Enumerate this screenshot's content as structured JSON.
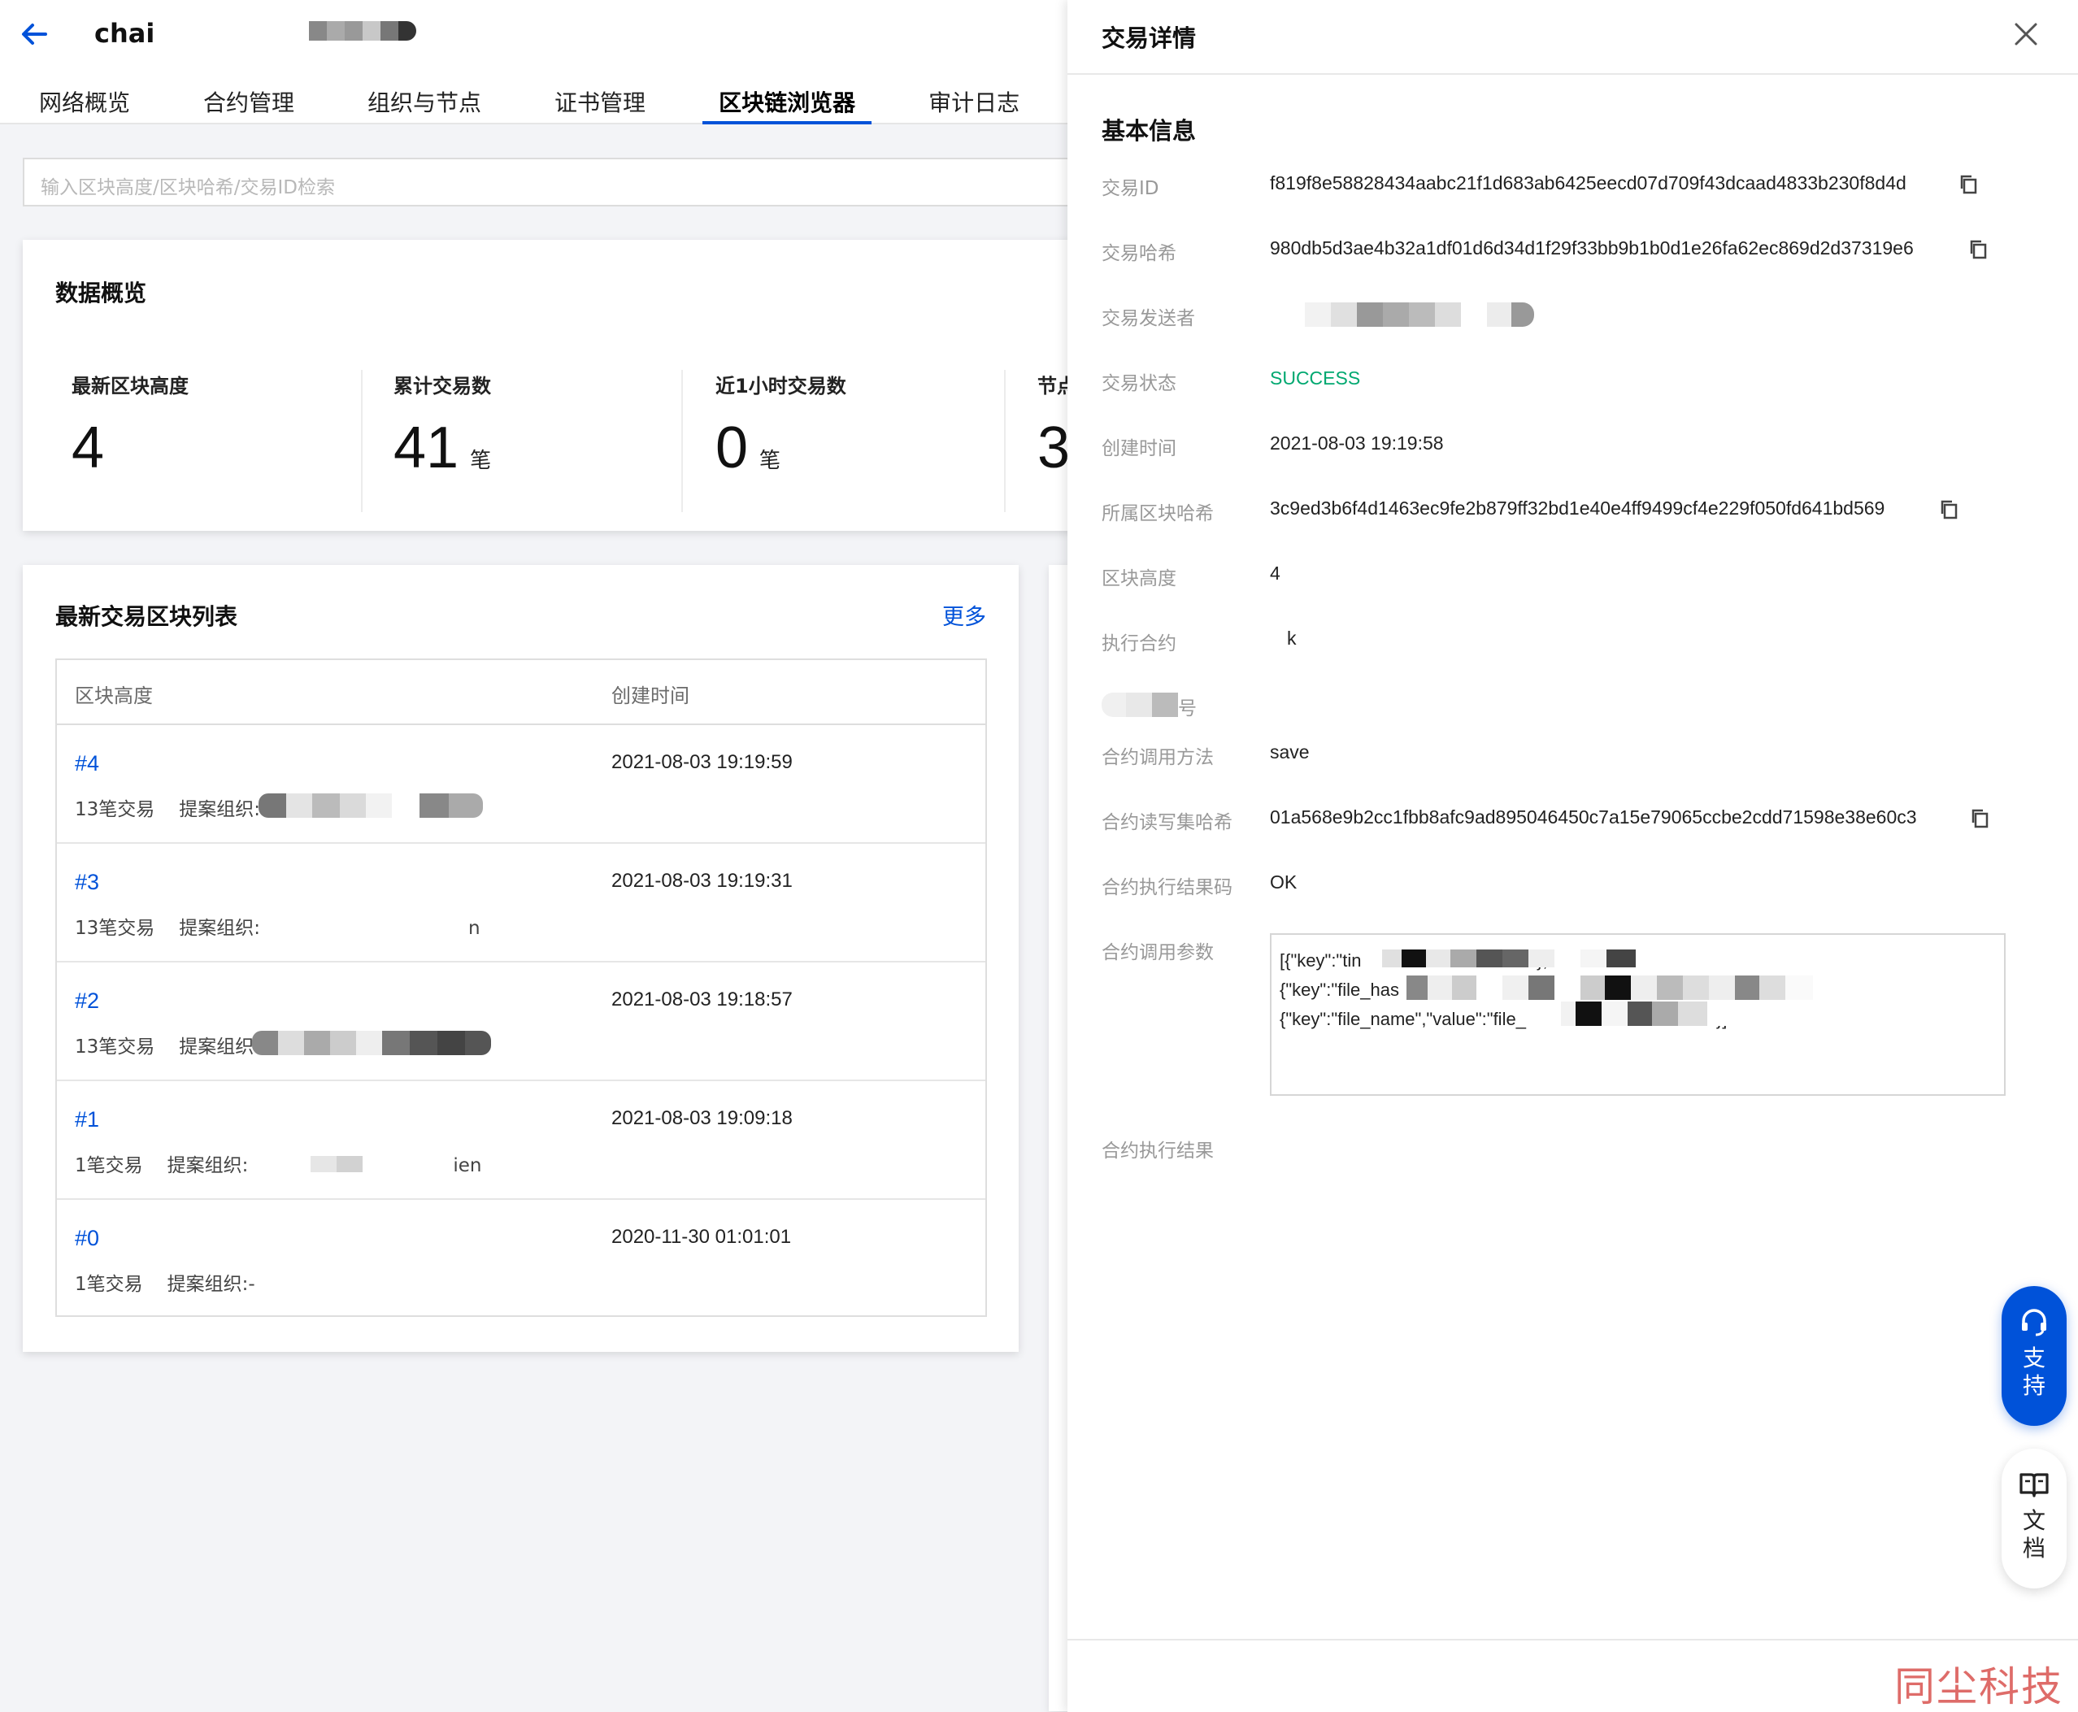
{
  "app": {
    "title": "chai",
    "nav_tabs": [
      {
        "label": "网络概览",
        "active": false
      },
      {
        "label": "合约管理",
        "active": false
      },
      {
        "label": "组织与节点",
        "active": false
      },
      {
        "label": "证书管理",
        "active": false
      },
      {
        "label": "区块链浏览器",
        "active": true
      },
      {
        "label": "审计日志",
        "active": false
      }
    ],
    "accent_color": "#0052d9"
  },
  "search": {
    "placeholder": "输入区块高度/区块哈希/交易ID检索"
  },
  "overview": {
    "title": "数据概览",
    "stats": [
      {
        "label": "最新区块高度",
        "value": "4",
        "unit": ""
      },
      {
        "label": "累计交易数",
        "value": "41",
        "unit": "笔"
      },
      {
        "label": "近1小时交易数",
        "value": "0",
        "unit": "笔"
      },
      {
        "label": "节点",
        "value": "3",
        "unit": ""
      }
    ]
  },
  "blocks": {
    "title": "最新交易区块列表",
    "more_label": "更多",
    "columns": [
      "区块高度",
      "创建时间"
    ],
    "rows": [
      {
        "height": "#4",
        "time": "2021-08-03 19:19:59",
        "tx": "13笔交易",
        "org_label": "提案组织:",
        "org_value": ""
      },
      {
        "height": "#3",
        "time": "2021-08-03 19:19:31",
        "tx": "13笔交易",
        "org_label": "提案组织:",
        "org_value": "n"
      },
      {
        "height": "#2",
        "time": "2021-08-03 19:18:57",
        "tx": "13笔交易",
        "org_label": "提案组织:",
        "org_value": ""
      },
      {
        "height": "#1",
        "time": "2021-08-03 19:09:18",
        "tx": "1笔交易",
        "org_label": "提案组织:",
        "org_value": "ien"
      },
      {
        "height": "#0",
        "time": "2020-11-30 01:01:01",
        "tx": "1笔交易",
        "org_label": "提案组织:",
        "org_value": "-"
      }
    ]
  },
  "drawer": {
    "title": "交易详情",
    "section": "基本信息",
    "fields": [
      {
        "label": "交易ID",
        "value": "f819f8e58828434aabc21f1d683ab6425eecd07d709f43dcaad4833b230f8d4d",
        "copy": true
      },
      {
        "label": "交易哈希",
        "value": "980db5d3ae4b32a1df01d6d34d1f29f33bb9b1b0d1e26fa62ec869d2d37319e6",
        "copy": true
      },
      {
        "label": "交易发送者",
        "value": "",
        "copy": false
      },
      {
        "label": "交易状态",
        "value": "SUCCESS",
        "copy": false,
        "status_color": "#00a870"
      },
      {
        "label": "创建时间",
        "value": "2021-08-03 19:19:58",
        "copy": false
      },
      {
        "label": "所属区块哈希",
        "value": "3c9ed3b6f4d1463ec9fe2b879ff32bd1e40e4ff9499cf4e229f050fd641bd569",
        "copy": true
      },
      {
        "label": "区块高度",
        "value": "4",
        "copy": false
      },
      {
        "label": "执行合约",
        "value": "k",
        "copy": false
      },
      {
        "label": "号",
        "value": "",
        "copy": false
      },
      {
        "label": "合约调用方法",
        "value": "save",
        "copy": false
      },
      {
        "label": "合约读写集哈希",
        "value": "01a568e9b2cc1fbb8afc9ad895046450c7a15e79065ccbe2cdd71598e38e60c3",
        "copy": true
      },
      {
        "label": "合约执行结果码",
        "value": "OK",
        "copy": false
      },
      {
        "label": "合约调用参数",
        "value": "",
        "copy": false
      },
      {
        "label": "合约执行结果",
        "value": "",
        "copy": false
      }
    ],
    "params_text": "[{\"key\":\"tin                                  \"},\n{\"key\":\"file_has                                                                   \"},\n{\"key\":\"file_name\",\"value\":\"file_                                     \"}]"
  },
  "floating": {
    "support_label_1": "支",
    "support_label_2": "持",
    "docs_label_1": "文",
    "docs_label_2": "档"
  },
  "watermark": "同尘科技"
}
